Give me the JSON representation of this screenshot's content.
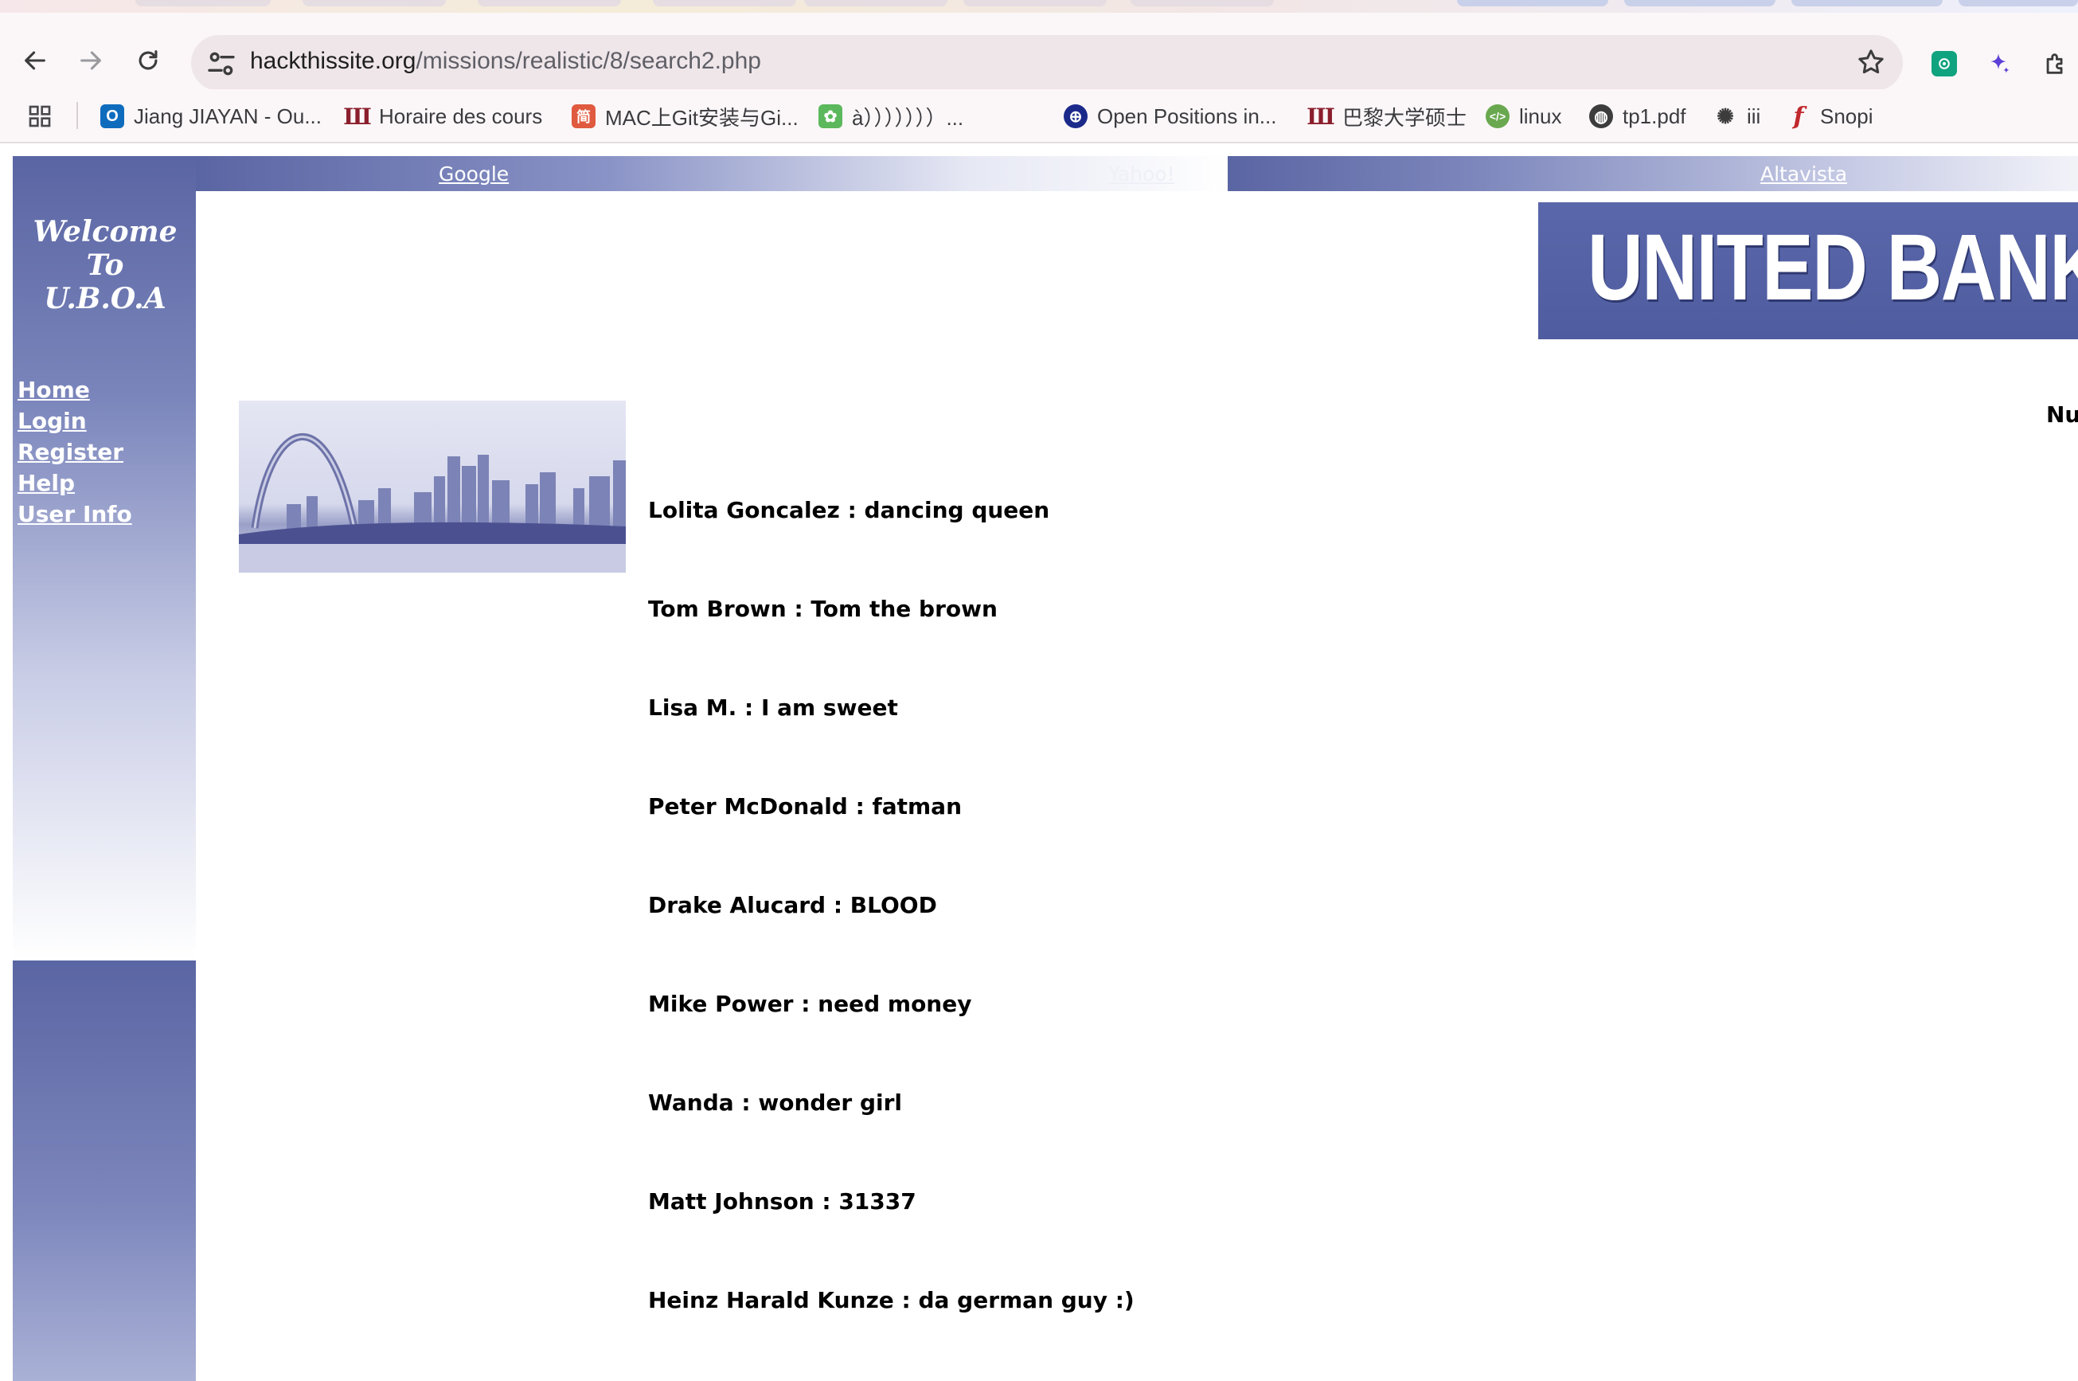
{
  "browser": {
    "url_host": "hackthissite.org",
    "url_path": "/missions/realistic/8/search2.php",
    "bookmarks": [
      {
        "label": "Jiang JIAYAN - Ou...",
        "icon": "outlook-icon",
        "color": "#0f6cbd"
      },
      {
        "label": "Horaire des cours",
        "icon": "university-icon",
        "color": "#8b1e2d"
      },
      {
        "label": "MAC上Git安装与Gi...",
        "icon": "jianshu-icon",
        "color": "#e05a3f"
      },
      {
        "label": "à）））））））...",
        "icon": "paw-icon",
        "color": "#5cb85c"
      },
      {
        "label": "Open Positions in...",
        "icon": "globe-grid-icon",
        "color": "#1b2a8a"
      },
      {
        "label": "巴黎大学硕士",
        "icon": "university-icon",
        "color": "#8b1e2d"
      },
      {
        "label": "linux",
        "icon": "code-icon",
        "color": "#6aa84f"
      },
      {
        "label": "tp1.pdf",
        "icon": "globe-icon",
        "color": "#3c3c3c"
      },
      {
        "label": "iii",
        "icon": "openai-icon",
        "color": "#3c3c3c"
      },
      {
        "label": "Snopi",
        "icon": "flash-icon",
        "color": "#c0282d"
      }
    ]
  },
  "site": {
    "welcome_line1": "Welcome To",
    "welcome_line2": "U.B.O.A",
    "nav": [
      "Home",
      "Login",
      "Register",
      "Help",
      "User Info"
    ],
    "top_links": [
      "Google",
      "Yahoo!",
      "Altavista"
    ],
    "banner_text": "UNITED BANKS OF AMERICA",
    "partial_label": "Nu",
    "results": [
      "Lolita Goncalez : dancing queen",
      "Tom Brown : Tom the brown",
      "Lisa M. : I am sweet",
      "Peter McDonald : fatman",
      "Drake Alucard : BLOOD",
      "Mike Power : need money",
      "Wanda : wonder girl",
      "Matt Johnson : 31337",
      "Heinz Harald Kunze : da german guy :)"
    ]
  },
  "colors": {
    "theme_blue": "#5a65a3",
    "text": "#000000",
    "link_white": "#ffffff"
  }
}
